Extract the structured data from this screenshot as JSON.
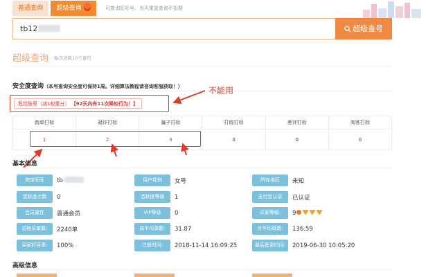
{
  "tabs": {
    "normal": "普通查询",
    "super": "超级查询",
    "tip": "可查询旺旺号、当天重复查询不扣费"
  },
  "search": {
    "value": "tb12",
    "button_label": "超级查号"
  },
  "page": {
    "title": "超级查询",
    "subtitle": "每次消耗10个查币"
  },
  "safety": {
    "title": "安全度查询",
    "note": "（本号查询安全度可保持1周。详细算法教程请咨询客服获取！）",
    "risk_label": "危险账号（减1权重分）",
    "risk_detail": "【92天内有11次降权行为！】",
    "annotation": "不能用"
  },
  "mark_table": {
    "headers": [
      "跑单打标",
      "敲诈打标",
      "骗子打标",
      "打假打标",
      "差评打标",
      "淘客打标"
    ],
    "values": [
      "1",
      "2",
      "3",
      "0",
      "0",
      "0"
    ]
  },
  "basic": {
    "title": "基本信息",
    "rows": [
      [
        {
          "label": "淘宝旺旺",
          "value": "tb"
        },
        {
          "label": "用户性别",
          "value": "女号"
        },
        {
          "label": "所在地区",
          "value": "未知"
        }
      ],
      [
        {
          "label": "活跃度点数",
          "value": "0"
        },
        {
          "label": "活跃度等级",
          "value": "1"
        },
        {
          "label": "支付宝认证",
          "value": "已认证"
        }
      ],
      [
        {
          "label": "会员属性",
          "value": "普通会员"
        },
        {
          "label": "VIP等级",
          "value": "0"
        },
        {
          "label": "买家等级:",
          "value": "9"
        }
      ],
      [
        {
          "label": "总购买单数:",
          "value": "2240单"
        },
        {
          "label": "周平均单数:",
          "value": "31.87"
        },
        {
          "label": "月平均单数:",
          "value": "136.59"
        }
      ],
      [
        {
          "label": "买家好评率:",
          "value": "100%"
        },
        {
          "label": "注册时间:",
          "value": "2018-11-14 16:09:25"
        },
        {
          "label": "最后登录时间:",
          "value": "2019-06-30 10:05:20"
        }
      ]
    ]
  },
  "advanced": {
    "title": "高级信息"
  },
  "colors": {
    "accent": "#f08a42",
    "tab_active": "#f28a2f",
    "label_bg": "#7cc0dc",
    "annotation_red": "#e23b2a"
  }
}
